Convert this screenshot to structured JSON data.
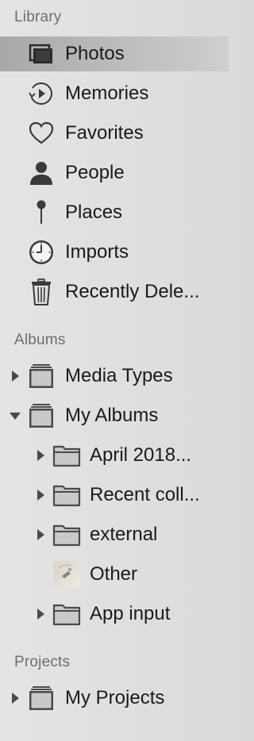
{
  "library": {
    "header": "Library",
    "items": [
      {
        "label": "Photos",
        "icon": "photos-stack-icon",
        "selected": true
      },
      {
        "label": "Memories",
        "icon": "memories-icon"
      },
      {
        "label": "Favorites",
        "icon": "heart-icon"
      },
      {
        "label": "People",
        "icon": "person-icon"
      },
      {
        "label": "Places",
        "icon": "pin-icon"
      },
      {
        "label": "Imports",
        "icon": "clock-icon"
      },
      {
        "label": "Recently Dele...",
        "icon": "trash-icon"
      }
    ]
  },
  "albums": {
    "header": "Albums",
    "items": [
      {
        "label": "Media Types",
        "icon": "album-stack-icon",
        "disclosure": "collapsed"
      },
      {
        "label": "My Albums",
        "icon": "album-stack-icon",
        "disclosure": "expanded"
      },
      {
        "label": "April 2018...",
        "icon": "folder-icon",
        "disclosure": "collapsed"
      },
      {
        "label": "Recent coll...",
        "icon": "folder-icon",
        "disclosure": "collapsed"
      },
      {
        "label": "external",
        "icon": "folder-icon",
        "disclosure": "collapsed"
      },
      {
        "label": "Other",
        "icon": "album-thumbnail-icon"
      },
      {
        "label": "App input",
        "icon": "folder-icon",
        "disclosure": "collapsed"
      }
    ]
  },
  "projects": {
    "header": "Projects",
    "items": [
      {
        "label": "My Projects",
        "icon": "album-stack-icon",
        "disclosure": "collapsed"
      }
    ]
  },
  "colors": {
    "selection": "#b3b3b3",
    "header_text": "#6e6e6e",
    "icon": "#3a3a3a"
  }
}
